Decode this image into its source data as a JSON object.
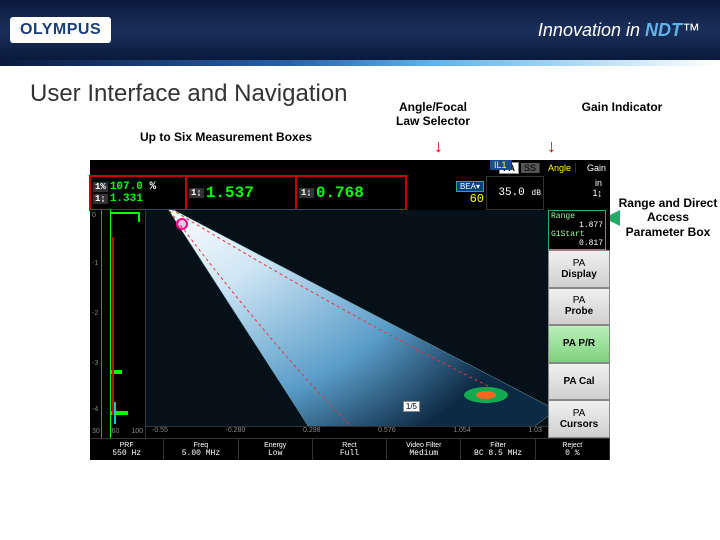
{
  "header": {
    "logo": "OLYMPUS",
    "tagline_prefix": "Innovation in ",
    "tagline_brand": "NDT",
    "tagline_tm": "™"
  },
  "slide_title": "User Interface and Navigation",
  "annotations": {
    "measurement_boxes": "Up to Six Measurement Boxes",
    "angle_selector": "Angle/Focal Law Selector",
    "gain_indicator": "Gain Indicator",
    "param_box": "Range and Direct Access Parameter Box"
  },
  "device": {
    "top_tabs": {
      "il": "IL1",
      "pa": "PA",
      "ss": "SS",
      "angle_label": "Angle",
      "angle_val": "60",
      "angle_dropdown": "BEA▾",
      "gain_label": "Gain",
      "gain_val": "35.0",
      "gain_unit": "dB"
    },
    "meas": [
      {
        "icon": "1%",
        "val_top": "107.0",
        "unit": "%",
        "icon2": "1↨",
        "val_bot": "1.331"
      },
      {
        "icon": "1↨",
        "val": "1.537"
      },
      {
        "icon": "1↨",
        "val": "0.768"
      }
    ],
    "params": {
      "range_label": "Range",
      "range_val": "1.877",
      "g1start_label": "G1Start",
      "g1start_val": "0.817"
    },
    "sidebar": [
      {
        "line1": "PA",
        "line2": "Display",
        "selected": false
      },
      {
        "line1": "PA",
        "line2": "Probe",
        "selected": false
      },
      {
        "line1": "PA P/R",
        "line2": "",
        "selected": true
      },
      {
        "line1": "PA Cal",
        "line2": "",
        "selected": false
      },
      {
        "line1": "PA",
        "line2": "Cursors",
        "selected": false
      }
    ],
    "sidebar_scale": {
      "unit": "in",
      "idx": "1↨"
    },
    "ascan_ticks": [
      "0",
      "-1",
      "-2",
      "-3",
      "-4"
    ],
    "ascan_bottom": [
      "30",
      "60",
      "100"
    ],
    "sector_bottom": [
      "-0.55",
      "-0.280",
      "0.298",
      "0.576",
      "1.054",
      "1.03"
    ],
    "bottom_bar": [
      {
        "label": "PRF",
        "value": "550 Hz"
      },
      {
        "label": "Freq",
        "value": "5.00 MHz"
      },
      {
        "label": "Energy",
        "value": "Low"
      },
      {
        "label": "Rect",
        "value": "Full"
      },
      {
        "label": "Video Filter",
        "value": "Medium"
      },
      {
        "label": "Filter",
        "value": "BC 8.5 MHz"
      },
      {
        "label": "Reject",
        "value": "0   %"
      }
    ],
    "page_indicator": "1/5"
  }
}
